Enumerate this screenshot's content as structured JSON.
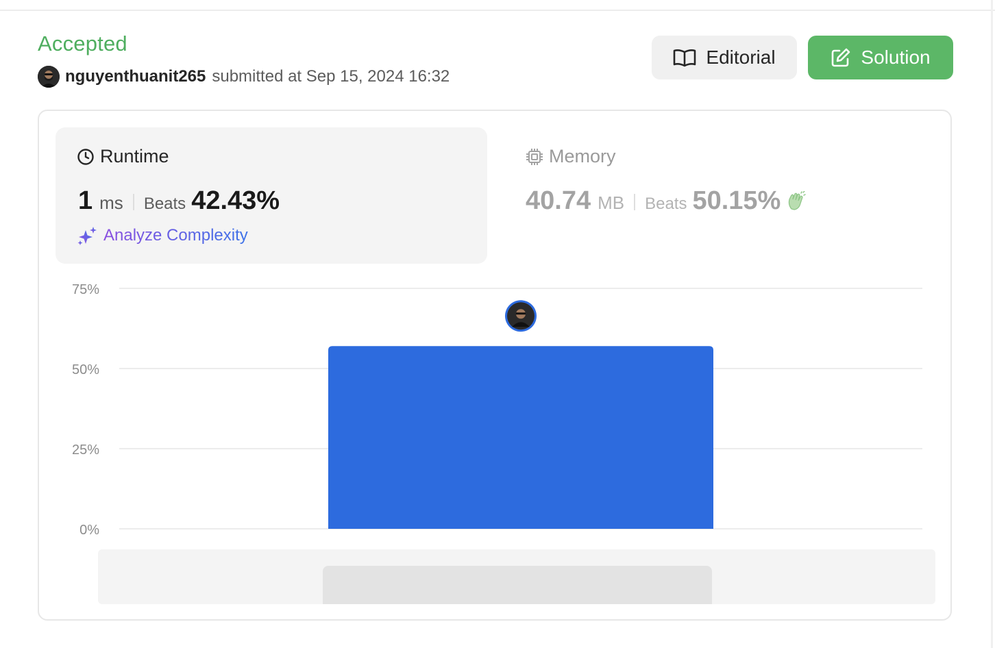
{
  "header": {
    "status": "Accepted",
    "username": "nguyenthuanit265",
    "submitted_text": "submitted at Sep 15, 2024 16:32"
  },
  "actions": {
    "editorial_label": "Editorial",
    "solution_label": "Solution"
  },
  "runtime": {
    "title": "Runtime",
    "value": "1",
    "unit": "ms",
    "beats_label": "Beats",
    "beats_pct": "42.43%",
    "analyze_label": "Analyze Complexity",
    "icon": "clock-icon"
  },
  "memory": {
    "title": "Memory",
    "value": "40.74",
    "unit": "MB",
    "beats_label": "Beats",
    "beats_pct": "50.15%",
    "icon": "chip-icon"
  },
  "colors": {
    "accepted": "#4fae5f",
    "solution_button": "#5cb767",
    "bar": "#2d6bde"
  },
  "chart_data": {
    "type": "bar",
    "y_tick_labels": [
      "0%",
      "25%",
      "50%",
      "75%"
    ],
    "ylim": [
      0,
      75
    ],
    "grid": true,
    "bars": [
      {
        "value": 57,
        "highlighted": true
      }
    ]
  }
}
